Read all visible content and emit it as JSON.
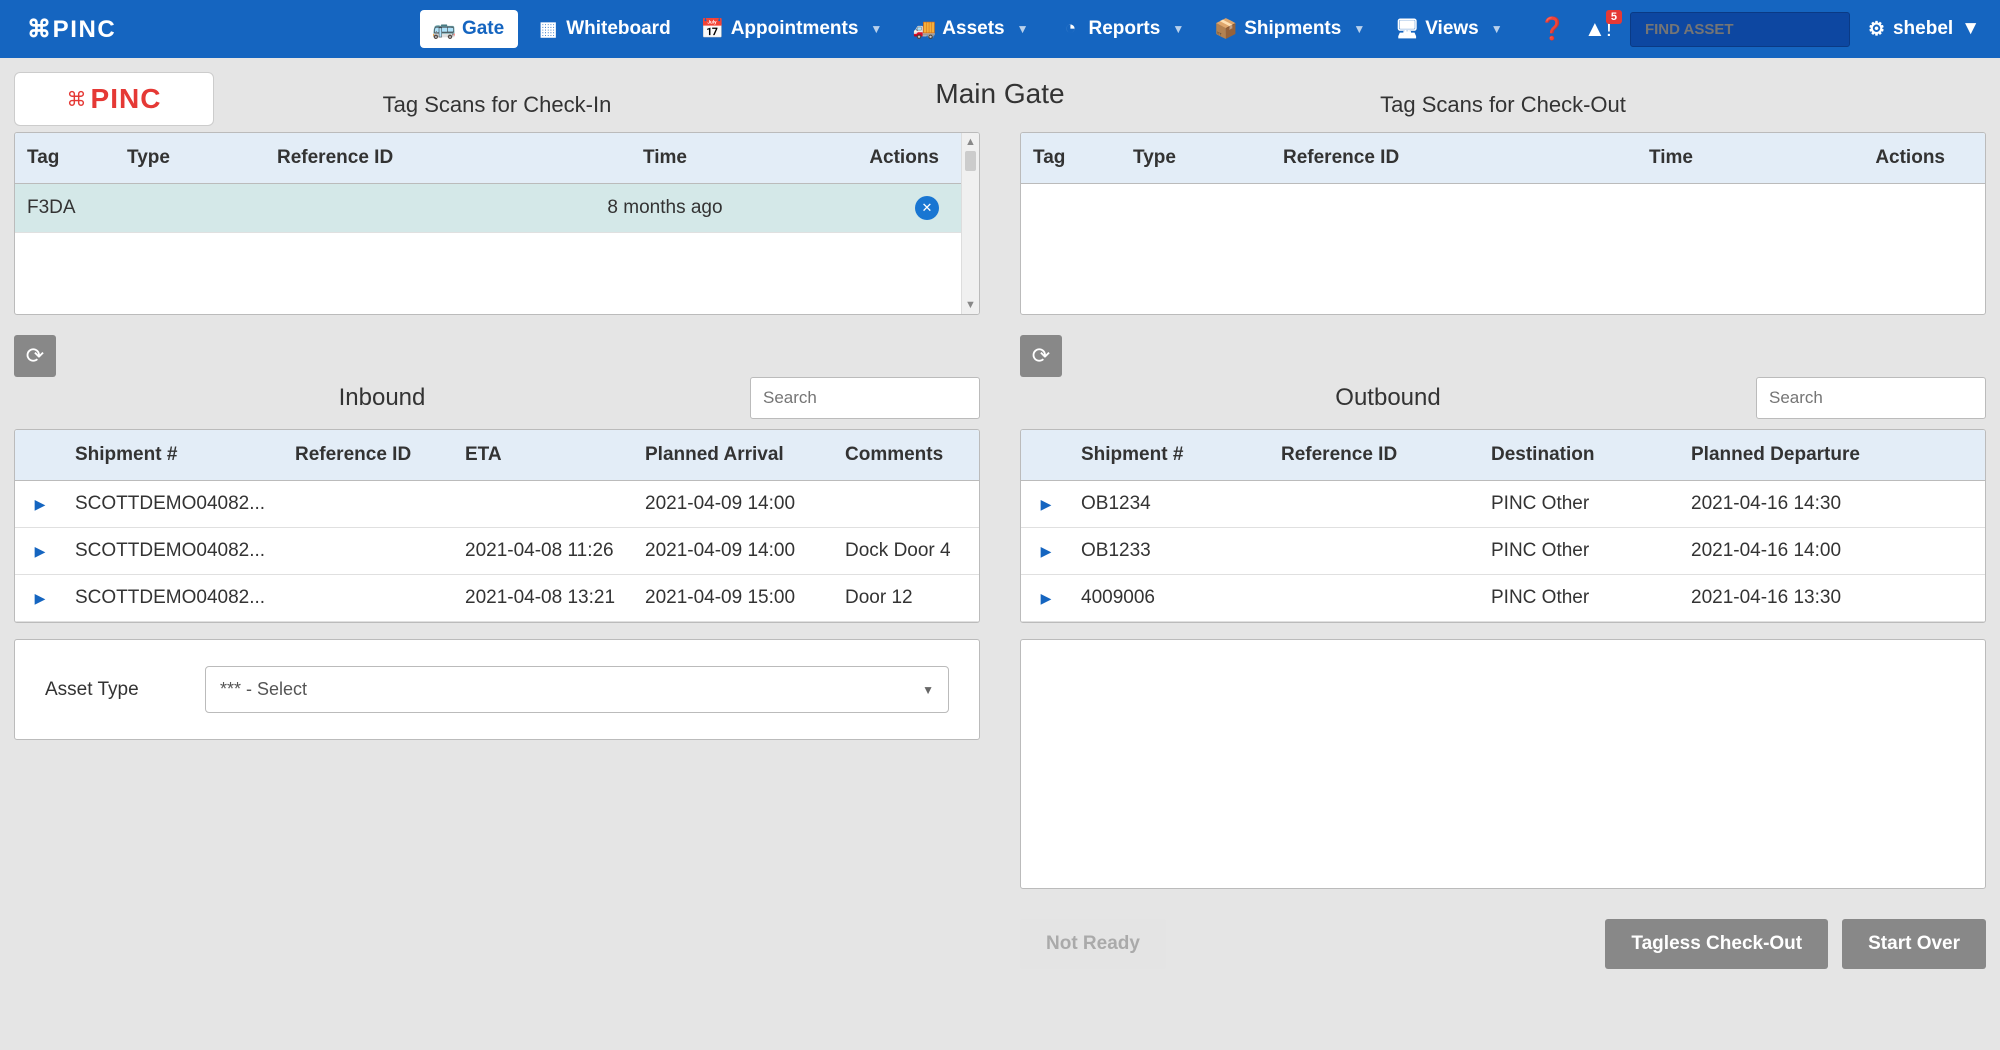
{
  "nav": {
    "gate": "Gate",
    "whiteboard": "Whiteboard",
    "appointments": "Appointments",
    "assets": "Assets",
    "reports": "Reports",
    "shipments": "Shipments",
    "views": "Views",
    "badge_count": "5",
    "find_asset_placeholder": "FIND ASSET",
    "user": "shebel"
  },
  "page": {
    "main_title": "Main Gate",
    "checkin_title": "Tag Scans for Check-In",
    "checkout_title": "Tag Scans for Check-Out",
    "logo_text": "PINC"
  },
  "scan_headers": {
    "tag": "Tag",
    "type": "Type",
    "ref": "Reference ID",
    "time": "Time",
    "actions": "Actions"
  },
  "checkin_rows": [
    {
      "tag": "F3DA",
      "type": "",
      "ref": "",
      "time": "8 months ago"
    }
  ],
  "inbound": {
    "title": "Inbound",
    "search_placeholder": "Search",
    "headers": {
      "shipment": "Shipment #",
      "ref": "Reference ID",
      "eta": "ETA",
      "planned": "Planned Arrival",
      "comments": "Comments"
    },
    "rows": [
      {
        "shipment": "SCOTTDEMO04082...",
        "ref": "",
        "eta": "",
        "planned": "2021-04-09 14:00",
        "comments": ""
      },
      {
        "shipment": "SCOTTDEMO04082...",
        "ref": "",
        "eta": "2021-04-08 11:26",
        "planned": "2021-04-09 14:00",
        "comments": "Dock Door 4"
      },
      {
        "shipment": "SCOTTDEMO04082...",
        "ref": "",
        "eta": "2021-04-08 13:21",
        "planned": "2021-04-09 15:00",
        "comments": "Door 12"
      }
    ]
  },
  "outbound": {
    "title": "Outbound",
    "search_placeholder": "Search",
    "headers": {
      "shipment": "Shipment #",
      "ref": "Reference ID",
      "dest": "Destination",
      "planned": "Planned Departure"
    },
    "rows": [
      {
        "shipment": "OB1234",
        "ref": "",
        "dest": "PINC Other",
        "planned": "2021-04-16 14:30"
      },
      {
        "shipment": "OB1233",
        "ref": "",
        "dest": "PINC Other",
        "planned": "2021-04-16 14:00"
      },
      {
        "shipment": "4009006",
        "ref": "",
        "dest": "PINC Other",
        "planned": "2021-04-16 13:30"
      }
    ]
  },
  "asset_type": {
    "label": "Asset Type",
    "selected": "*** - Select"
  },
  "buttons": {
    "not_ready": "Not Ready",
    "tagless": "Tagless Check-Out",
    "start_over": "Start Over"
  }
}
